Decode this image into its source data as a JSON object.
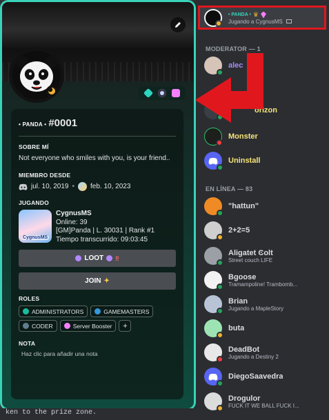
{
  "profile": {
    "clan_tag": "• PANDA •",
    "discriminator": "#0001",
    "about_heading": "SOBRE MÍ",
    "about_text": "Not everyone who smiles with you, is your friend..",
    "member_since_heading": "MIEMBRO DESDE",
    "discord_since": "jul. 10, 2019",
    "server_since": "feb. 10, 2023",
    "activity_heading": "JUGANDO",
    "activity_image_label": "CygnusMS",
    "activity_name": "CygnusMS",
    "activity_line1": "Online: 39",
    "activity_line2": "[GM]Panda | L. 30031 | Rank #1",
    "activity_line3": "Tiempo transcurrido: 09:03:45",
    "button_loot": "LOOT",
    "button_join": "JOIN",
    "roles_heading": "ROLES",
    "roles": [
      {
        "name": "ADMINISTRATORS",
        "color": "#1abc9c"
      },
      {
        "name": "GAMEMASTERS",
        "color": "#3498db"
      },
      {
        "name": "CODER",
        "color": "#607d8b"
      },
      {
        "name": "Server Booster",
        "color": "#f47fff"
      }
    ],
    "role_add_label": "+",
    "note_heading": "NOTA",
    "note_placeholder": "Haz clic para añadir una nota"
  },
  "bottom_text": "ken to the prize zone.",
  "members": {
    "self": {
      "name": "• PANDA •",
      "activity": "Jugando a CygnusMS"
    },
    "groups": [
      {
        "header": "MODERATOR — 1"
      },
      {
        "header": "EN LÍNEA — 83"
      }
    ],
    "list": [
      {
        "name": "alec",
        "activity": ""
      },
      {
        "name": "orizon",
        "activity": ""
      },
      {
        "name": "Monster",
        "activity": ""
      },
      {
        "name": "Uninstall",
        "activity": ""
      },
      {
        "name": "\"hattun\"",
        "activity": ""
      },
      {
        "name": "2+2=5",
        "activity": ""
      },
      {
        "name": "Aligatet Ͼolt",
        "activity": "Street couch LIFE"
      },
      {
        "name": "Bgoose",
        "activity": "Tramampoline! Trambomb..."
      },
      {
        "name": "Brian",
        "activity": "Jugando a MapleStory"
      },
      {
        "name": "buta",
        "activity": ""
      },
      {
        "name": "DeadBot",
        "activity": "Jugando a Destiny 2"
      },
      {
        "name": "DiegoSaavedra",
        "activity": ""
      },
      {
        "name": "Drogulor",
        "activity": "FUCK IT WE BALL FUCK I..."
      }
    ]
  },
  "colors": {
    "accent_border": "#39d3b9",
    "highlight_red": "#e0181e",
    "moderator_name": "#a78bfa",
    "monster_name": "#f7e479"
  }
}
